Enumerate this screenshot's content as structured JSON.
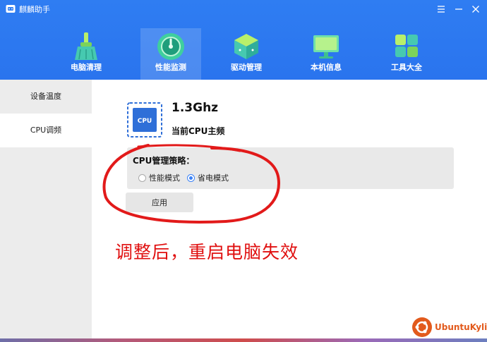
{
  "window": {
    "title": "麒麟助手"
  },
  "nav": {
    "items": [
      {
        "label": "电脑清理",
        "icon": "broom-icon"
      },
      {
        "label": "性能监测",
        "icon": "gauge-icon",
        "active": true
      },
      {
        "label": "驱动管理",
        "icon": "cube-icon"
      },
      {
        "label": "本机信息",
        "icon": "monitor-icon"
      },
      {
        "label": "工具大全",
        "icon": "grid-icon"
      }
    ]
  },
  "sidebar": {
    "items": [
      {
        "label": "设备温度"
      },
      {
        "label": "CPU调频",
        "active": true
      }
    ]
  },
  "cpu": {
    "chip_label": "CPU",
    "frequency": "1.3Ghz",
    "frequency_label": "当前CPU主频"
  },
  "policy": {
    "title": "CPU管理策略：",
    "options": [
      {
        "label": "性能模式",
        "checked": false
      },
      {
        "label": "省电模式",
        "checked": true
      }
    ],
    "apply_label": "应用"
  },
  "annotation": {
    "text": "调整后，重启电脑失效"
  },
  "watermark": {
    "text": "UbuntuKylin"
  },
  "colors": {
    "accent": "#2f7df2",
    "annotation": "#e01010"
  }
}
